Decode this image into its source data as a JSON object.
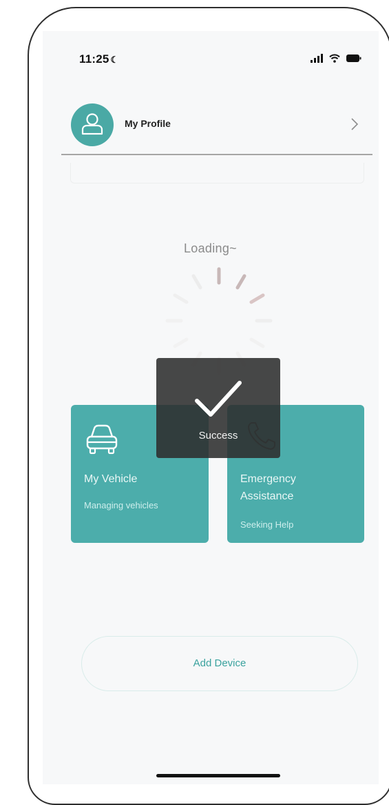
{
  "status_bar": {
    "time": "11:25",
    "moon_icon": "moon-icon",
    "icons": [
      "signal-icon",
      "wifi-icon",
      "battery-icon"
    ]
  },
  "profile": {
    "label": "My Profile",
    "avatar_icon": "user-icon",
    "chevron_icon": "chevron-right-icon"
  },
  "loading": {
    "text": "Loading~"
  },
  "cards": [
    {
      "title": "My Vehicle",
      "subtitle": "Managing vehicles",
      "icon": "car-icon"
    },
    {
      "title_line1": "Emergency",
      "title_line2": "Assistance",
      "subtitle": "Seeking Help",
      "icon": "phone-icon"
    }
  ],
  "toast": {
    "text": "Success",
    "icon": "checkmark-icon"
  },
  "add_device": {
    "label": "Add Device"
  },
  "colors": {
    "accent": "#4cadab",
    "accent_text": "#3aa29e",
    "toast_bg": "#2d2d2d",
    "screen_bg": "#f7f8f9"
  }
}
